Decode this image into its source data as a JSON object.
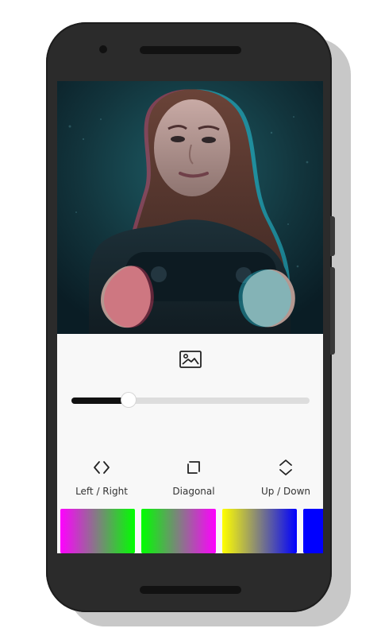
{
  "preview": {
    "photo_alt": "Glitch photo preview"
  },
  "controls": {
    "image_icon": "image-icon",
    "intensity_fraction": 0.24
  },
  "directions": [
    {
      "label": "Left / Right",
      "icon": "left-right-arrows-icon"
    },
    {
      "label": "Diagonal",
      "icon": "diagonal-icon"
    },
    {
      "label": "Up / Down",
      "icon": "up-down-arrows-icon"
    }
  ],
  "swatches": [
    {
      "name": "magenta-green",
      "from": "#ff00ff",
      "to": "#00ff00"
    },
    {
      "name": "green-magenta",
      "from": "#00ff00",
      "to": "#ff00ff"
    },
    {
      "name": "yellow-blue",
      "from": "#ffff00",
      "to": "#0000ff"
    },
    {
      "name": "blue",
      "from": "#0000ff",
      "to": "#0000ff"
    }
  ]
}
